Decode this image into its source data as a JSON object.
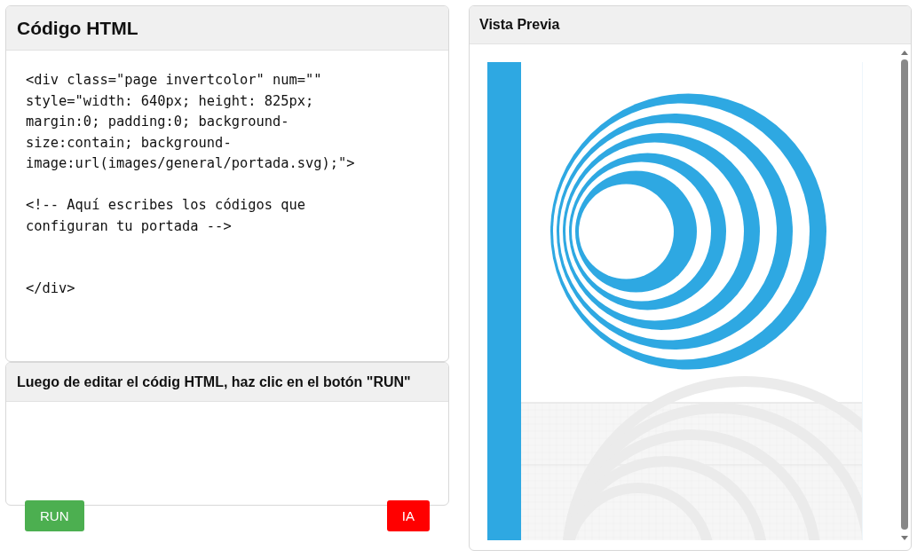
{
  "editor": {
    "title": "Código HTML",
    "code": "<div class=\"page invertcolor\" num=\"\"\nstyle=\"width: 640px; height: 825px;\nmargin:0; padding:0; background-\nsize:contain; background-\nimage:url(images/general/portada.svg);\">\n\n<!-- Aquí escribes los códigos que\nconfiguran tu portada -->\n\n\n</div>"
  },
  "instructions": {
    "title": "Luego de editar el códig HTML, haz clic en el botón \"RUN\""
  },
  "buttons": [
    {
      "kind": "run",
      "label": "RUN"
    },
    {
      "kind": "ai",
      "label": "IA"
    }
  ],
  "preview": {
    "title": "Vista Previa"
  }
}
